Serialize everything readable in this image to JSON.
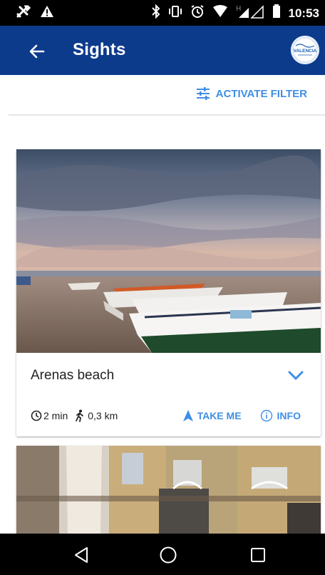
{
  "status_bar": {
    "time": "10:53",
    "icons": [
      "tools-icon",
      "warning-icon",
      "bluetooth-icon",
      "vibrate-icon",
      "alarm-icon",
      "wifi-icon",
      "signal-icon",
      "battery-icon"
    ]
  },
  "app_bar": {
    "title": "Sights",
    "logo_text": "VALENCIA",
    "colors": {
      "background": "#0d3b8c"
    }
  },
  "filter": {
    "label": "ACTIVATE FILTER",
    "icon": "filter-sliders-icon"
  },
  "cards": [
    {
      "title": "Arenas beach",
      "time": "2 min",
      "distance": "0,3 km",
      "actions": {
        "take_me": "TAKE ME",
        "info": "INFO"
      },
      "image": "beach-boats-photo"
    },
    {
      "image": "baroque-palace-facade-photo"
    }
  ],
  "accent_color": "#3f8ee6"
}
